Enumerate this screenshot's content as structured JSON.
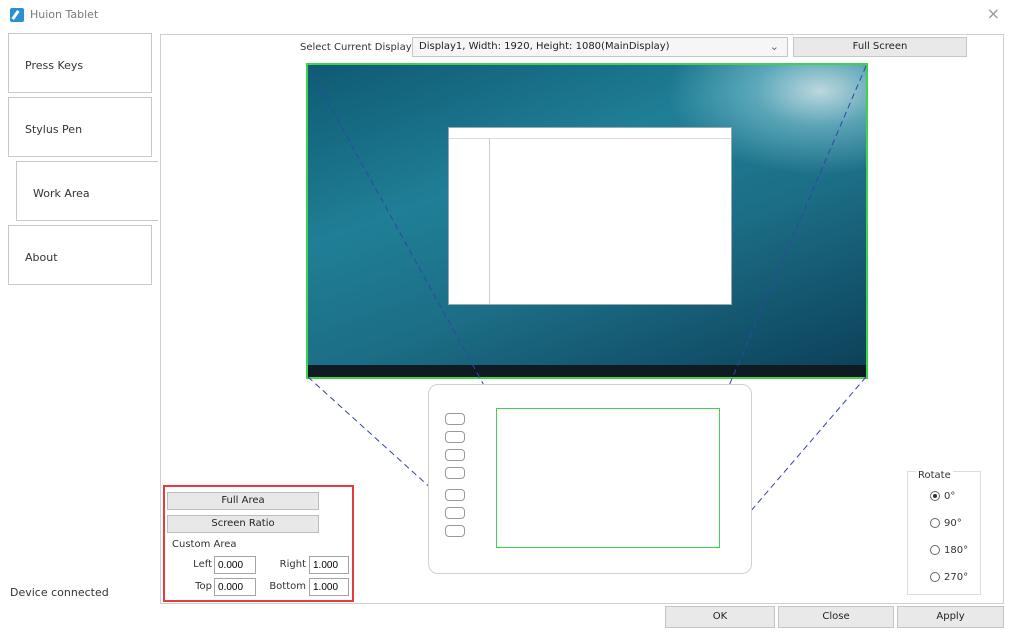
{
  "window": {
    "title": "Huion Tablet",
    "close_icon": "×"
  },
  "sidebar": {
    "items": [
      {
        "label": "Press Keys"
      },
      {
        "label": "Stylus Pen"
      },
      {
        "label": "Work Area"
      },
      {
        "label": "About"
      }
    ],
    "status": "Device connected"
  },
  "display": {
    "label": "Select Current Display",
    "selected": "Display1, Width: 1920, Height: 1080(MainDisplay)",
    "full_screen": "Full Screen"
  },
  "area": {
    "full_area": "Full Area",
    "screen_ratio": "Screen Ratio",
    "custom_title": "Custom Area",
    "left_label": "Left",
    "left_value": "0.000",
    "right_label": "Right",
    "right_value": "1.000",
    "top_label": "Top",
    "top_value": "0.000",
    "bottom_label": "Bottom",
    "bottom_value": "1.000"
  },
  "rotate": {
    "title": "Rotate",
    "options": [
      "0°",
      "90°",
      "180°",
      "270°"
    ],
    "selected": "0°"
  },
  "footer": {
    "ok": "OK",
    "close": "Close",
    "apply": "Apply"
  },
  "colors": {
    "work_area_outline": "#41d24b",
    "highlight_border": "#e53b3b"
  }
}
